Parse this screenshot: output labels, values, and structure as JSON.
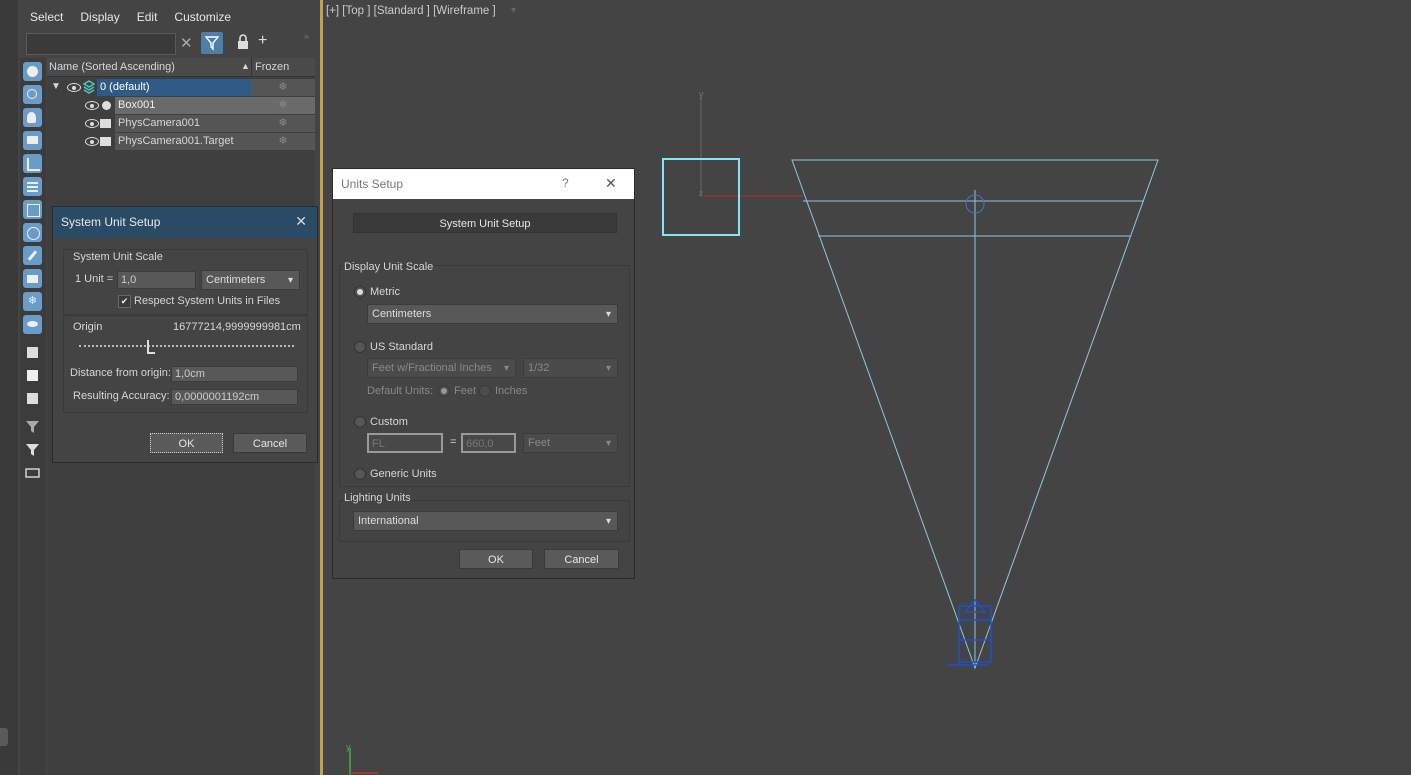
{
  "menubar": {
    "items": [
      "Select",
      "Display",
      "Edit",
      "Customize"
    ]
  },
  "explorer": {
    "columns": {
      "name": "Name (Sorted Ascending)",
      "frozen": "Frozen"
    },
    "rows": [
      {
        "name": "0 (default)",
        "frozen": "❄"
      },
      {
        "name": "Box001",
        "frozen": "❄"
      },
      {
        "name": "PhysCamera001",
        "frozen": "❄"
      },
      {
        "name": "PhysCamera001.Target",
        "frozen": "❄"
      }
    ]
  },
  "system_dialog": {
    "title": "System Unit Setup",
    "scale_group": "System Unit Scale",
    "unit_label": "1 Unit =",
    "unit_value": "1,0",
    "unit_type": "Centimeters",
    "respect_label": "Respect System Units in Files",
    "origin_label": "Origin",
    "origin_value": "16777214,9999999981cm",
    "distance_label": "Distance from origin:",
    "distance_value": "1,0cm",
    "accuracy_label": "Resulting Accuracy:",
    "accuracy_value": "0,0000001192cm",
    "ok": "OK",
    "cancel": "Cancel"
  },
  "units_dialog": {
    "title": "Units Setup",
    "help": "?",
    "system_button": "System Unit Setup",
    "display_group": "Display Unit Scale",
    "metric_label": "Metric",
    "metric_value": "Centimeters",
    "us_label": "US Standard",
    "us_value": "Feet w/Fractional Inches",
    "us_fraction": "1/32",
    "default_units_label": "Default Units:",
    "feet_label": "Feet",
    "inches_label": "Inches",
    "custom_label": "Custom",
    "custom_name": "FL",
    "custom_eq": "=",
    "custom_value": "660,0",
    "custom_unit": "Feet",
    "generic_label": "Generic Units",
    "lighting_group": "Lighting Units",
    "lighting_value": "International",
    "ok": "OK",
    "cancel": "Cancel"
  },
  "viewport": {
    "label": "[+] [Top ] [Standard ] [Wireframe ]",
    "axis_y": "y",
    "axis_z": "z",
    "corner_y": "y"
  }
}
